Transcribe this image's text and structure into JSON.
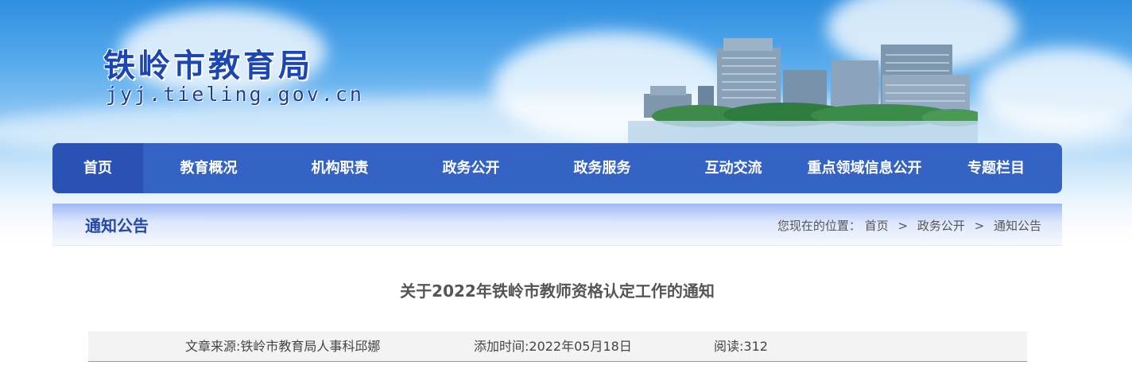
{
  "header": {
    "site_title": "铁岭市教育局",
    "site_domain": "jyj.tieling.gov.cn"
  },
  "nav": {
    "items": [
      {
        "label": "首页",
        "active": true
      },
      {
        "label": "教育概况"
      },
      {
        "label": "机构职责"
      },
      {
        "label": "政务公开"
      },
      {
        "label": "政务服务"
      },
      {
        "label": "互动交流"
      },
      {
        "label": "重点领域信息公开"
      },
      {
        "label": "专题栏目"
      }
    ]
  },
  "section": {
    "title": "通知公告",
    "breadcrumb_prefix": "您现在的位置：",
    "breadcrumb": [
      "首页",
      "政务公开",
      "通知公告"
    ],
    "breadcrumb_sep": ">"
  },
  "article": {
    "title": "关于2022年铁岭市教师资格认定工作的通知",
    "source": "文章来源:铁岭市教育局人事科邱娜",
    "added_time": "添加时间:2022年05月18日",
    "reads": "阅读:312"
  },
  "colors": {
    "nav_bg": "#3462c5",
    "nav_active": "#2a52b4",
    "title_blue": "#1b46b3",
    "section_title": "#2548a8"
  }
}
